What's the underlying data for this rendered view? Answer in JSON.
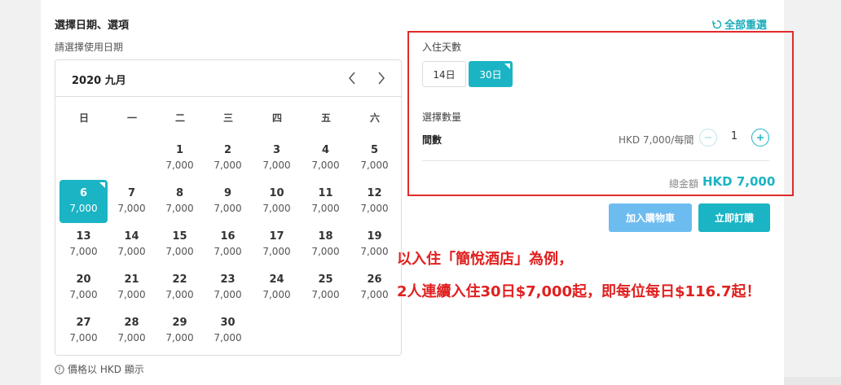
{
  "header": {
    "title": "選擇日期、選項",
    "reset_label": "全部重選",
    "subtitle": "請選擇使用日期"
  },
  "calendar": {
    "month_label": "2020 九月",
    "weekdays": [
      "日",
      "一",
      "二",
      "三",
      "四",
      "五",
      "六"
    ],
    "days": [
      {
        "day": "1",
        "price": "7,000"
      },
      {
        "day": "2",
        "price": "7,000"
      },
      {
        "day": "3",
        "price": "7,000"
      },
      {
        "day": "4",
        "price": "7,000"
      },
      {
        "day": "5",
        "price": "7,000"
      },
      {
        "day": "6",
        "price": "7,000",
        "selected": true
      },
      {
        "day": "7",
        "price": "7,000"
      },
      {
        "day": "8",
        "price": "7,000"
      },
      {
        "day": "9",
        "price": "7,000"
      },
      {
        "day": "10",
        "price": "7,000"
      },
      {
        "day": "11",
        "price": "7,000"
      },
      {
        "day": "12",
        "price": "7,000"
      },
      {
        "day": "13",
        "price": "7,000"
      },
      {
        "day": "14",
        "price": "7,000"
      },
      {
        "day": "15",
        "price": "7,000"
      },
      {
        "day": "16",
        "price": "7,000"
      },
      {
        "day": "17",
        "price": "7,000"
      },
      {
        "day": "18",
        "price": "7,000"
      },
      {
        "day": "19",
        "price": "7,000"
      },
      {
        "day": "20",
        "price": "7,000"
      },
      {
        "day": "21",
        "price": "7,000"
      },
      {
        "day": "22",
        "price": "7,000"
      },
      {
        "day": "23",
        "price": "7,000"
      },
      {
        "day": "24",
        "price": "7,000"
      },
      {
        "day": "25",
        "price": "7,000"
      },
      {
        "day": "26",
        "price": "7,000"
      },
      {
        "day": "27",
        "price": "7,000"
      },
      {
        "day": "28",
        "price": "7,000"
      },
      {
        "day": "29",
        "price": "7,000"
      },
      {
        "day": "30",
        "price": "7,000"
      }
    ],
    "note": "價格以 HKD 顯示"
  },
  "options": {
    "stay_days_label": "入住天數",
    "day_options": [
      "14日",
      "30日"
    ],
    "selected_day_option": "30日",
    "quantity_label": "選擇數量",
    "room_label": "間數",
    "unit_price": "HKD 7,000/每間",
    "quantity": "1",
    "total_label": "總金額",
    "total_value": "HKD 7,000"
  },
  "buttons": {
    "add_to_cart": "加入購物車",
    "buy_now": "立即訂購"
  },
  "promo": {
    "line1": "以入住「簡悅酒店」為例，",
    "line2": "2人連續入住30日$7,000起，即每位每日$116.7起！"
  },
  "colors": {
    "accent": "#1ab4c4",
    "cart_button": "#6dbcf0",
    "highlight_red": "#e02b2b"
  }
}
